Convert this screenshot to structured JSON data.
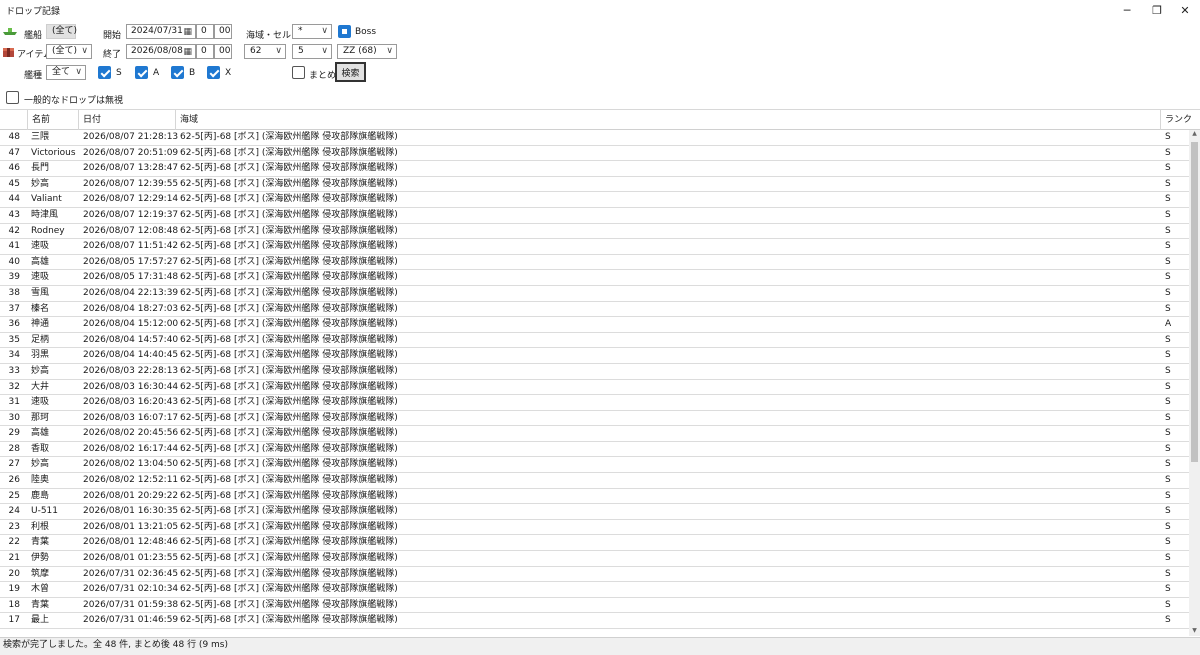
{
  "window": {
    "title": "ドロップ記録",
    "minimize": "─",
    "maximize": "❐",
    "close": "✕"
  },
  "filters": {
    "ship_label": "艦船",
    "ship_value": "(全て)",
    "item_label": "アイテム",
    "item_value": "(全て)",
    "shiptype_label": "艦種",
    "shiptype_value": "全て",
    "start_label": "開始",
    "start_date": "2024/07/31",
    "start_hour": "0",
    "start_min": "00",
    "end_label": "終了",
    "end_date": "2026/08/08",
    "end_hour": "0",
    "end_min": "00",
    "area_label": "海域・セル",
    "area_value": "*",
    "map_value": "62",
    "submap_value": "5",
    "cell_value": "ZZ (68)",
    "boss_label": "Boss",
    "boss_checked": true,
    "rank_s_label": "S",
    "rank_a_label": "A",
    "rank_b_label": "B",
    "rank_x_label": "X",
    "merge_label": "まとめる",
    "search_label": "検索",
    "ignore_common_label": "一般的なドロップは無視"
  },
  "grid": {
    "headers": {
      "name": "名前",
      "date": "日付",
      "area": "海域",
      "rank": "ランク"
    },
    "rows": [
      {
        "no": "48",
        "name": "三隈",
        "date": "2026/08/07 21:28:13",
        "area": "62-5[丙]-68 [ボス] (深海欧州艦隊 侵攻部隊旗艦戦隊)",
        "rank": "S"
      },
      {
        "no": "47",
        "name": "Victorious",
        "date": "2026/08/07 20:51:09",
        "area": "62-5[丙]-68 [ボス] (深海欧州艦隊 侵攻部隊旗艦戦隊)",
        "rank": "S"
      },
      {
        "no": "46",
        "name": "長門",
        "date": "2026/08/07 13:28:47",
        "area": "62-5[丙]-68 [ボス] (深海欧州艦隊 侵攻部隊旗艦戦隊)",
        "rank": "S"
      },
      {
        "no": "45",
        "name": "妙高",
        "date": "2026/08/07 12:39:55",
        "area": "62-5[丙]-68 [ボス] (深海欧州艦隊 侵攻部隊旗艦戦隊)",
        "rank": "S"
      },
      {
        "no": "44",
        "name": "Valiant",
        "date": "2026/08/07 12:29:14",
        "area": "62-5[丙]-68 [ボス] (深海欧州艦隊 侵攻部隊旗艦戦隊)",
        "rank": "S"
      },
      {
        "no": "43",
        "name": "時津風",
        "date": "2026/08/07 12:19:37",
        "area": "62-5[丙]-68 [ボス] (深海欧州艦隊 侵攻部隊旗艦戦隊)",
        "rank": "S"
      },
      {
        "no": "42",
        "name": "Rodney",
        "date": "2026/08/07 12:08:48",
        "area": "62-5[丙]-68 [ボス] (深海欧州艦隊 侵攻部隊旗艦戦隊)",
        "rank": "S"
      },
      {
        "no": "41",
        "name": "速吸",
        "date": "2026/08/07 11:51:42",
        "area": "62-5[丙]-68 [ボス] (深海欧州艦隊 侵攻部隊旗艦戦隊)",
        "rank": "S"
      },
      {
        "no": "40",
        "name": "高雄",
        "date": "2026/08/05 17:57:27",
        "area": "62-5[丙]-68 [ボス] (深海欧州艦隊 侵攻部隊旗艦戦隊)",
        "rank": "S"
      },
      {
        "no": "39",
        "name": "速吸",
        "date": "2026/08/05 17:31:48",
        "area": "62-5[丙]-68 [ボス] (深海欧州艦隊 侵攻部隊旗艦戦隊)",
        "rank": "S"
      },
      {
        "no": "38",
        "name": "雪風",
        "date": "2026/08/04 22:13:39",
        "area": "62-5[丙]-68 [ボス] (深海欧州艦隊 侵攻部隊旗艦戦隊)",
        "rank": "S"
      },
      {
        "no": "37",
        "name": "榛名",
        "date": "2026/08/04 18:27:03",
        "area": "62-5[丙]-68 [ボス] (深海欧州艦隊 侵攻部隊旗艦戦隊)",
        "rank": "S"
      },
      {
        "no": "36",
        "name": "神通",
        "date": "2026/08/04 15:12:00",
        "area": "62-5[丙]-68 [ボス] (深海欧州艦隊 侵攻部隊旗艦戦隊)",
        "rank": "A"
      },
      {
        "no": "35",
        "name": "足柄",
        "date": "2026/08/04 14:57:40",
        "area": "62-5[丙]-68 [ボス] (深海欧州艦隊 侵攻部隊旗艦戦隊)",
        "rank": "S"
      },
      {
        "no": "34",
        "name": "羽黒",
        "date": "2026/08/04 14:40:45",
        "area": "62-5[丙]-68 [ボス] (深海欧州艦隊 侵攻部隊旗艦戦隊)",
        "rank": "S"
      },
      {
        "no": "33",
        "name": "妙高",
        "date": "2026/08/03 22:28:13",
        "area": "62-5[丙]-68 [ボス] (深海欧州艦隊 侵攻部隊旗艦戦隊)",
        "rank": "S"
      },
      {
        "no": "32",
        "name": "大井",
        "date": "2026/08/03 16:30:44",
        "area": "62-5[丙]-68 [ボス] (深海欧州艦隊 侵攻部隊旗艦戦隊)",
        "rank": "S"
      },
      {
        "no": "31",
        "name": "速吸",
        "date": "2026/08/03 16:20:43",
        "area": "62-5[丙]-68 [ボス] (深海欧州艦隊 侵攻部隊旗艦戦隊)",
        "rank": "S"
      },
      {
        "no": "30",
        "name": "那珂",
        "date": "2026/08/03 16:07:17",
        "area": "62-5[丙]-68 [ボス] (深海欧州艦隊 侵攻部隊旗艦戦隊)",
        "rank": "S"
      },
      {
        "no": "29",
        "name": "高雄",
        "date": "2026/08/02 20:45:56",
        "area": "62-5[丙]-68 [ボス] (深海欧州艦隊 侵攻部隊旗艦戦隊)",
        "rank": "S"
      },
      {
        "no": "28",
        "name": "香取",
        "date": "2026/08/02 16:17:44",
        "area": "62-5[丙]-68 [ボス] (深海欧州艦隊 侵攻部隊旗艦戦隊)",
        "rank": "S"
      },
      {
        "no": "27",
        "name": "妙高",
        "date": "2026/08/02 13:04:50",
        "area": "62-5[丙]-68 [ボス] (深海欧州艦隊 侵攻部隊旗艦戦隊)",
        "rank": "S"
      },
      {
        "no": "26",
        "name": "陸奥",
        "date": "2026/08/02 12:52:11",
        "area": "62-5[丙]-68 [ボス] (深海欧州艦隊 侵攻部隊旗艦戦隊)",
        "rank": "S"
      },
      {
        "no": "25",
        "name": "鹿島",
        "date": "2026/08/01 20:29:22",
        "area": "62-5[丙]-68 [ボス] (深海欧州艦隊 侵攻部隊旗艦戦隊)",
        "rank": "S"
      },
      {
        "no": "24",
        "name": "U-511",
        "date": "2026/08/01 16:30:35",
        "area": "62-5[丙]-68 [ボス] (深海欧州艦隊 侵攻部隊旗艦戦隊)",
        "rank": "S"
      },
      {
        "no": "23",
        "name": "利根",
        "date": "2026/08/01 13:21:05",
        "area": "62-5[丙]-68 [ボス] (深海欧州艦隊 侵攻部隊旗艦戦隊)",
        "rank": "S"
      },
      {
        "no": "22",
        "name": "青葉",
        "date": "2026/08/01 12:48:46",
        "area": "62-5[丙]-68 [ボス] (深海欧州艦隊 侵攻部隊旗艦戦隊)",
        "rank": "S"
      },
      {
        "no": "21",
        "name": "伊勢",
        "date": "2026/08/01 01:23:55",
        "area": "62-5[丙]-68 [ボス] (深海欧州艦隊 侵攻部隊旗艦戦隊)",
        "rank": "S"
      },
      {
        "no": "20",
        "name": "筑摩",
        "date": "2026/07/31 02:36:45",
        "area": "62-5[丙]-68 [ボス] (深海欧州艦隊 侵攻部隊旗艦戦隊)",
        "rank": "S"
      },
      {
        "no": "19",
        "name": "木曾",
        "date": "2026/07/31 02:10:34",
        "area": "62-5[丙]-68 [ボス] (深海欧州艦隊 侵攻部隊旗艦戦隊)",
        "rank": "S"
      },
      {
        "no": "18",
        "name": "青葉",
        "date": "2026/07/31 01:59:38",
        "area": "62-5[丙]-68 [ボス] (深海欧州艦隊 侵攻部隊旗艦戦隊)",
        "rank": "S"
      },
      {
        "no": "17",
        "name": "最上",
        "date": "2026/07/31 01:46:59",
        "area": "62-5[丙]-68 [ボス] (深海欧州艦隊 侵攻部隊旗艦戦隊)",
        "rank": "S"
      }
    ]
  },
  "status": {
    "text": "検索が完了しました。全 48 件, まとめ後 48 行 (9 ms)"
  }
}
